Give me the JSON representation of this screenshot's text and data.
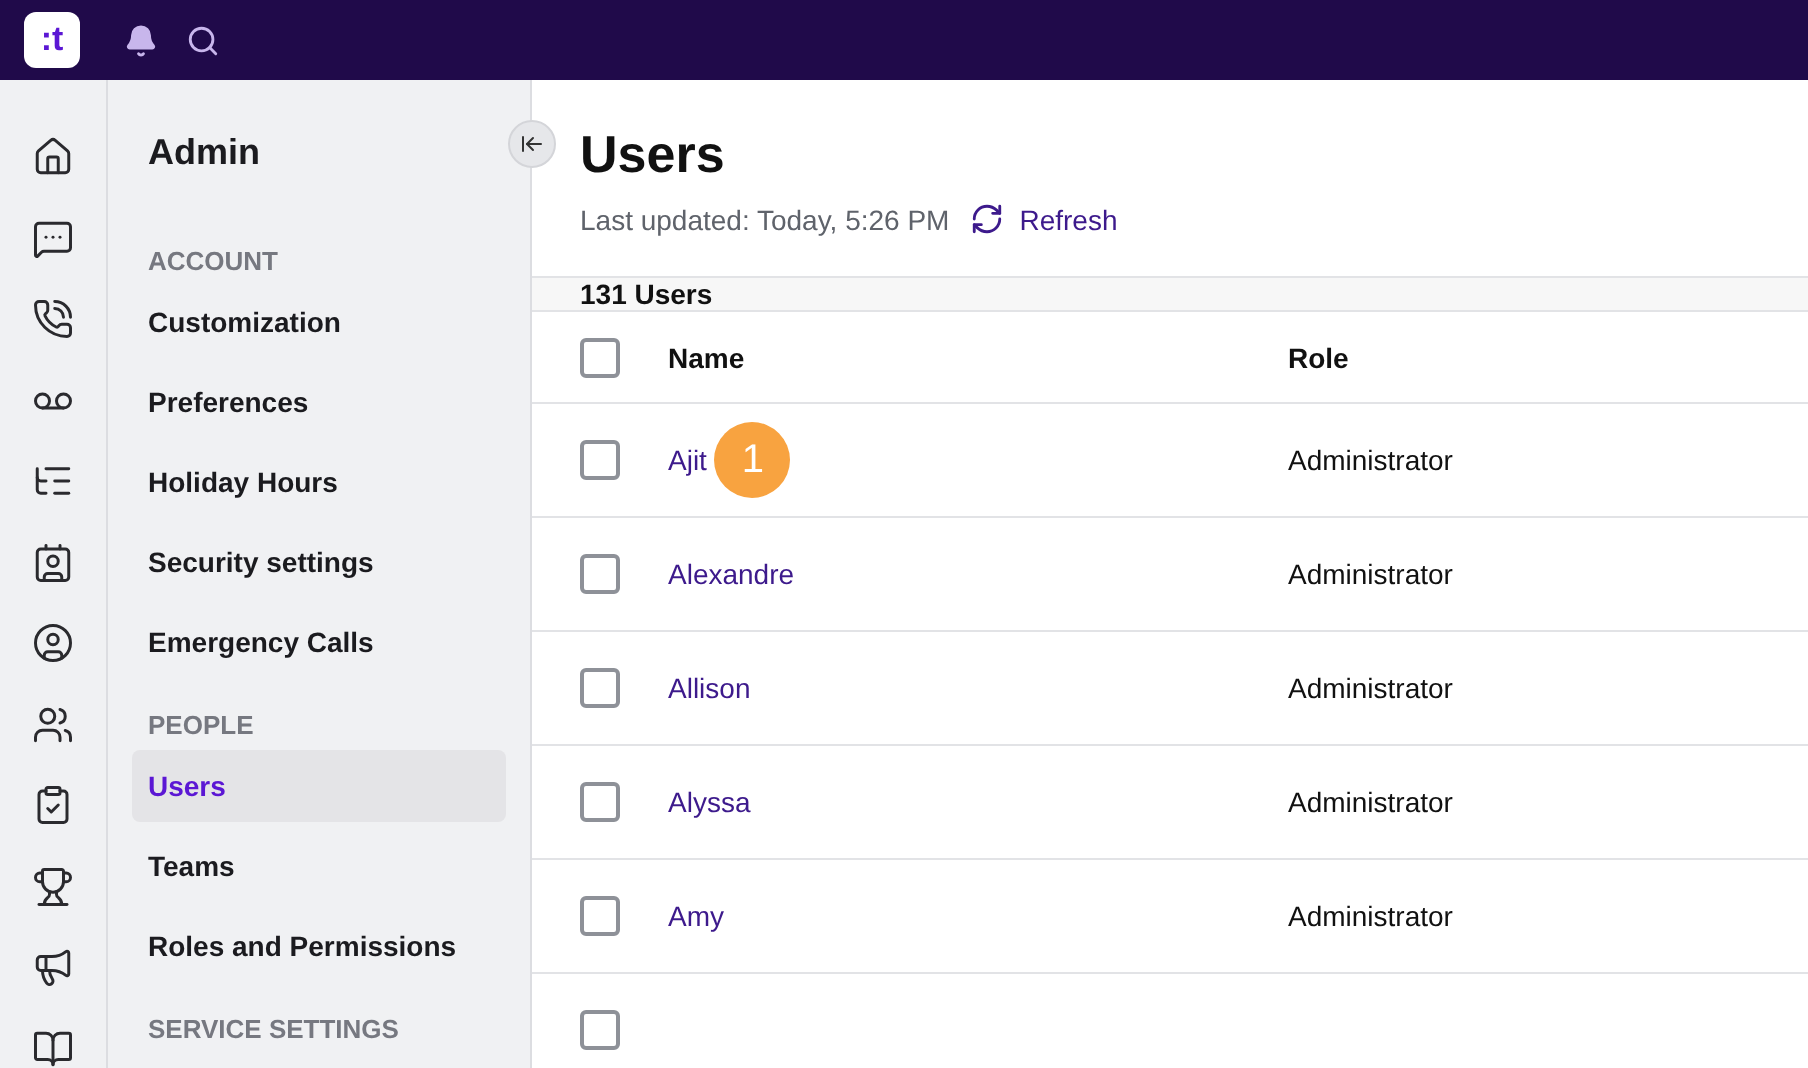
{
  "logo": {
    "text": ":t"
  },
  "sidebar": {
    "title": "Admin",
    "sections": [
      {
        "heading": "ACCOUNT",
        "items": [
          {
            "label": "Customization",
            "selected": false
          },
          {
            "label": "Preferences",
            "selected": false
          },
          {
            "label": "Holiday Hours",
            "selected": false
          },
          {
            "label": "Security settings",
            "selected": false
          },
          {
            "label": "Emergency Calls",
            "selected": false
          }
        ]
      },
      {
        "heading": "PEOPLE",
        "items": [
          {
            "label": "Users",
            "selected": true
          },
          {
            "label": "Teams",
            "selected": false
          },
          {
            "label": "Roles and Permissions",
            "selected": false
          }
        ]
      },
      {
        "heading": "SERVICE SETTINGS"
      }
    ]
  },
  "page": {
    "title": "Users",
    "last_updated": "Last updated: Today, 5:26 PM",
    "refresh": "Refresh"
  },
  "table": {
    "count": "131 Users",
    "select_all_checked": false,
    "columns": [
      "Name",
      "Role"
    ],
    "rows": [
      {
        "name": "Ajit",
        "role": "Administrator",
        "checked": false,
        "badge": "1"
      },
      {
        "name": "Alexandre",
        "role": "Administrator",
        "checked": false
      },
      {
        "name": "Allison",
        "role": "Administrator",
        "checked": false
      },
      {
        "name": "Alyssa",
        "role": "Administrator",
        "checked": false
      },
      {
        "name": "Amy",
        "role": "Administrator",
        "checked": false
      }
    ],
    "partial_row": {
      "checked": false
    }
  }
}
